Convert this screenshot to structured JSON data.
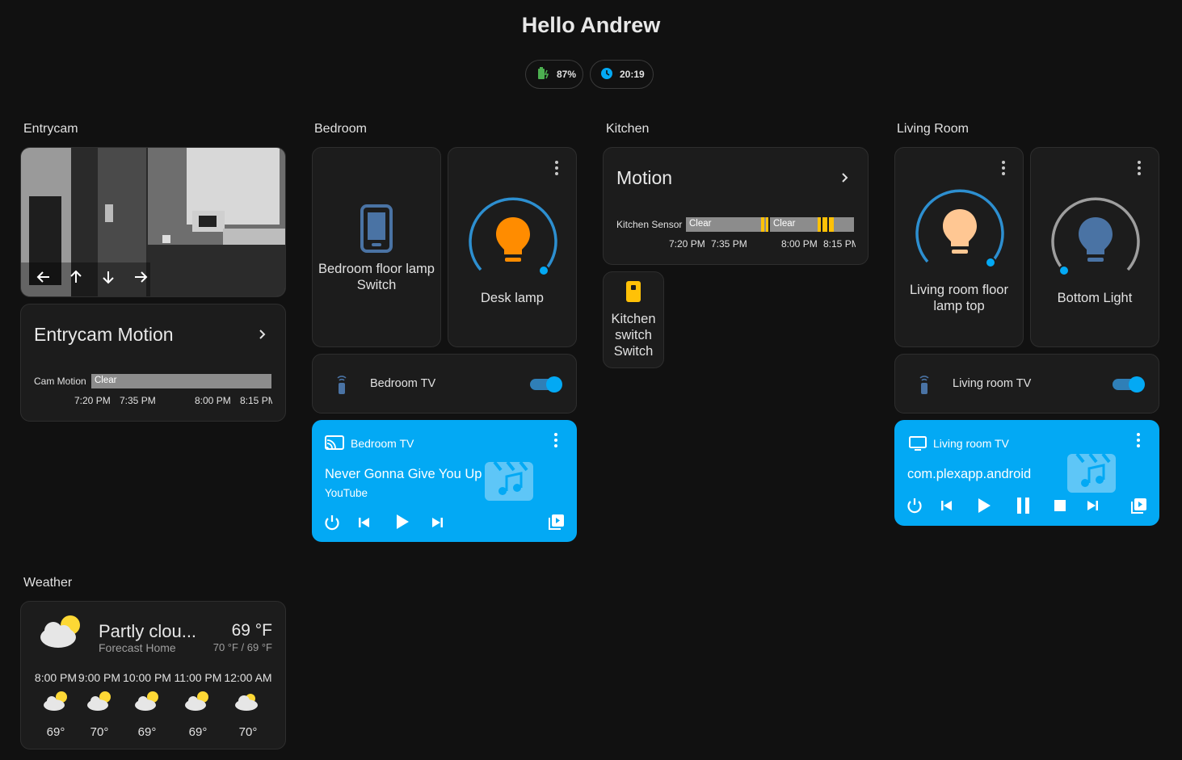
{
  "header": {
    "title": "Hello Andrew"
  },
  "badges": {
    "battery": "87%",
    "time": "20:19"
  },
  "colors": {
    "accent": "#03a9f4",
    "lamp_on": "#ff8c00",
    "lamp_peach": "#ffc793",
    "lamp_blue": "#4a73a4",
    "yellow": "#ffc107",
    "bar_grey": "#8c8c8c"
  },
  "entrycam": {
    "section": "Entrycam",
    "arrows": [
      "arrow-left-icon",
      "arrow-up-icon",
      "arrow-down-icon",
      "arrow-right-icon"
    ],
    "motion_title": "Entrycam Motion",
    "row_label": "Cam Motion",
    "state": "Clear",
    "ticks": [
      "7:20 PM",
      "7:35 PM",
      "8:00 PM",
      "8:15 PM"
    ]
  },
  "bedroom": {
    "section": "Bedroom",
    "switch_name": "Bedroom floor lamp Switch",
    "lamp_name": "Desk lamp",
    "tv_name": "Bedroom TV",
    "player": {
      "name": "Bedroom TV",
      "title": "Never Gonna Give You Up",
      "app": "YouTube"
    }
  },
  "kitchen": {
    "section": "Kitchen",
    "motion_title": "Motion",
    "row_label": "Kitchen Sensor",
    "state1": "Clear",
    "state2": "Clear",
    "ticks": [
      "7:20 PM",
      "7:35 PM",
      "8:00 PM",
      "8:15 PM"
    ],
    "switch_name": "Kitchen switch Switch"
  },
  "living": {
    "section": "Living Room",
    "lamp1_name": "Living room floor lamp top",
    "lamp2_name": "Bottom Light",
    "tv_name": "Living room TV",
    "player": {
      "name": "Living room TV",
      "title": "com.plexapp.android"
    }
  },
  "weather": {
    "section": "Weather",
    "condition": "Partly clou...",
    "location": "Forecast Home",
    "temp": "69 °F",
    "range": "70 °F / 69 °F",
    "forecast": [
      {
        "time": "8:00 PM",
        "temp": "69°"
      },
      {
        "time": "9:00 PM",
        "temp": "70°"
      },
      {
        "time": "10:00 PM",
        "temp": "69°"
      },
      {
        "time": "11:00 PM",
        "temp": "69°"
      },
      {
        "time": "12:00 AM",
        "temp": "70°"
      }
    ]
  }
}
